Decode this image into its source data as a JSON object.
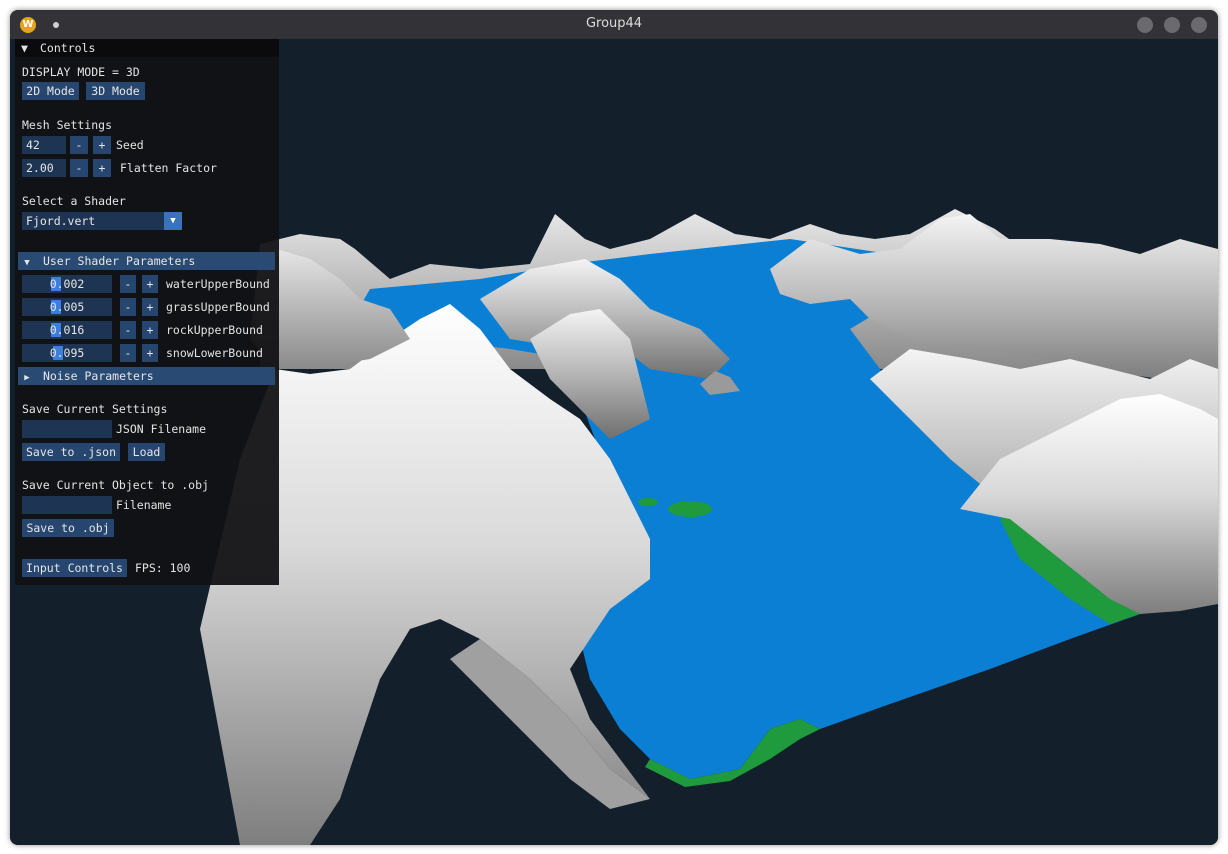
{
  "window": {
    "title": "Group44",
    "app_icon_letter": "W"
  },
  "controls": {
    "header": "Controls",
    "display_mode": "DISPLAY MODE = 3D",
    "mode_buttons": {
      "mode2d": "2D Mode",
      "mode3d": "3D Mode"
    },
    "mesh": {
      "section_label": "Mesh Settings",
      "seed_value": "42",
      "seed_label": "Seed",
      "flatten_value": "2.00",
      "flatten_label": "Flatten Factor",
      "minus": "-",
      "plus": "+"
    },
    "shader": {
      "section_label": "Select a Shader",
      "selected": "Fjord.vert"
    },
    "user_shader_params": {
      "header": "User Shader Parameters",
      "params": [
        {
          "label": "waterUpperBound",
          "value": "0.002",
          "fraction": 0.3
        },
        {
          "label": "grassUpperBound",
          "value": "0.005",
          "fraction": 0.3
        },
        {
          "label": "rockUpperBound",
          "value": "0.016",
          "fraction": 0.3
        },
        {
          "label": "snowLowerBound",
          "value": "0.095",
          "fraction": 0.33
        }
      ]
    },
    "noise_params": {
      "header": "Noise Parameters"
    },
    "save_settings": {
      "section_label": "Save Current Settings",
      "json_filename_value": "",
      "json_filename_label": "JSON Filename",
      "save_json": "Save to .json",
      "load": "Load"
    },
    "save_object": {
      "section_label": "Save Current Object to .obj",
      "filename_value": "",
      "filename_label": "Filename",
      "save_obj": "Save to .obj"
    },
    "footer": {
      "input_controls": "Input Controls",
      "fps": "FPS: 100"
    }
  },
  "colors": {
    "background": "#13202b",
    "water": "#0a7fd4",
    "grass": "#1f9a3c",
    "rock": "#8c8c8c",
    "snow": "#f2f2f2",
    "button": "#27466f",
    "header": "#294a72"
  }
}
